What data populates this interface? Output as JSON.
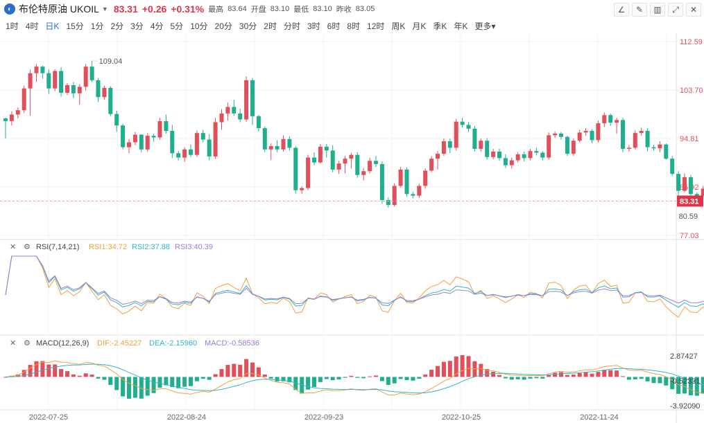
{
  "header": {
    "logo_letter": "◐",
    "symbol": "布伦特原油 UKOIL",
    "price": "83.31",
    "change": "+0.26",
    "change_pct": "+0.31%",
    "high_label": "最高",
    "high": "83.64",
    "open_label": "开盘",
    "open": "83.10",
    "low_label": "最低",
    "low": "83.10",
    "prev_label": "昨收",
    "prev": "83.05"
  },
  "timeframes": [
    "1时",
    "4时",
    "日K",
    "15分",
    "1分",
    "2分",
    "3分",
    "4分",
    "5分",
    "10分",
    "20分",
    "30分",
    "2时",
    "分时",
    "3时",
    "6时",
    "8时",
    "12时",
    "周K",
    "月K",
    "季K",
    "年K",
    "更多"
  ],
  "active_timeframe": "日K",
  "colors": {
    "up": "#e0505a",
    "down": "#1fae8e",
    "accent": "#2a6ccf"
  },
  "chart_data": {
    "type": "candlestick",
    "price_axis": {
      "ticks": [
        112.59,
        103.7,
        94.81,
        85.92,
        77.03
      ],
      "range": [
        76.5,
        113.5
      ],
      "current": "83.31"
    },
    "annotations": {
      "max": "109.04",
      "min": "80.59"
    },
    "dates": [
      "2022-07-25",
      "2022-08-24",
      "2022-09-23",
      "2022-10-25",
      "2022-11-24"
    ],
    "candles": [
      [
        98.5,
        98.6,
        94.8,
        98.0
      ],
      [
        98.0,
        99.8,
        97.2,
        99.2
      ],
      [
        99.2,
        100.5,
        98.5,
        100.0
      ],
      [
        100.0,
        104.5,
        99.5,
        104.0
      ],
      [
        104.0,
        107.5,
        99.0,
        106.8
      ],
      [
        106.8,
        108.5,
        105.2,
        108.0
      ],
      [
        108.0,
        108.2,
        105.8,
        106.8
      ],
      [
        106.8,
        107.5,
        103.0,
        104.0
      ],
      [
        104.0,
        107.5,
        103.5,
        107.2
      ],
      [
        107.2,
        107.9,
        102.5,
        103.2
      ],
      [
        103.2,
        105.0,
        102.8,
        104.6
      ],
      [
        104.6,
        105.2,
        102.2,
        103.1
      ],
      [
        103.1,
        104.8,
        101.0,
        104.3
      ],
      [
        104.3,
        108.5,
        103.6,
        108.0
      ],
      [
        108.0,
        109.04,
        105.2,
        105.5
      ],
      [
        105.5,
        105.9,
        101.5,
        102.4
      ],
      [
        102.4,
        104.5,
        101.9,
        104.1
      ],
      [
        104.1,
        104.4,
        98.9,
        99.3
      ],
      [
        99.3,
        99.9,
        96.0,
        97.2
      ],
      [
        97.2,
        97.5,
        92.8,
        93.2
      ],
      [
        93.2,
        94.7,
        92.1,
        94.1
      ],
      [
        94.1,
        96.0,
        93.6,
        95.5
      ],
      [
        95.5,
        95.6,
        92.3,
        92.8
      ],
      [
        92.8,
        95.8,
        92.4,
        95.3
      ],
      [
        95.3,
        95.7,
        94.2,
        95.0
      ],
      [
        95.0,
        98.6,
        94.6,
        98.0
      ],
      [
        98.0,
        99.2,
        95.7,
        96.2
      ],
      [
        96.2,
        97.3,
        91.2,
        92.1
      ],
      [
        92.1,
        92.5,
        90.8,
        91.3
      ],
      [
        91.3,
        93.2,
        90.5,
        92.8
      ],
      [
        92.8,
        93.7,
        91.4,
        91.8
      ],
      [
        91.8,
        96.3,
        91.4,
        95.8
      ],
      [
        95.8,
        96.4,
        94.1,
        94.6
      ],
      [
        94.6,
        95.6,
        90.8,
        91.5
      ],
      [
        91.5,
        98.6,
        91.1,
        97.8
      ],
      [
        97.8,
        100.2,
        96.4,
        99.4
      ],
      [
        99.4,
        101.4,
        98.1,
        100.6
      ],
      [
        100.6,
        101.9,
        99.0,
        99.4
      ],
      [
        99.4,
        100.3,
        97.8,
        98.3
      ],
      [
        98.3,
        106.2,
        97.9,
        105.5
      ],
      [
        105.5,
        105.9,
        97.3,
        98.9
      ],
      [
        98.9,
        99.1,
        96.1,
        96.7
      ],
      [
        96.7,
        97.0,
        92.3,
        92.8
      ],
      [
        92.8,
        93.9,
        90.9,
        93.4
      ],
      [
        93.4,
        94.5,
        92.3,
        92.8
      ],
      [
        92.8,
        95.4,
        92.4,
        94.7
      ],
      [
        94.7,
        95.2,
        92.6,
        93.1
      ],
      [
        93.1,
        93.4,
        84.7,
        85.3
      ],
      [
        85.3,
        86.0,
        84.6,
        85.7
      ],
      [
        85.7,
        91.8,
        85.3,
        91.3
      ],
      [
        91.3,
        92.3,
        89.9,
        90.4
      ],
      [
        90.4,
        93.8,
        90.2,
        93.3
      ],
      [
        93.3,
        93.8,
        91.3,
        92.6
      ],
      [
        92.6,
        93.6,
        88.6,
        89.1
      ],
      [
        89.1,
        90.7,
        88.3,
        90.2
      ],
      [
        90.2,
        91.6,
        88.4,
        91.1
      ],
      [
        91.1,
        92.2,
        89.3,
        91.8
      ],
      [
        91.8,
        92.3,
        87.6,
        88.1
      ],
      [
        88.1,
        89.4,
        87.1,
        88.8
      ],
      [
        88.8,
        91.3,
        88.4,
        90.7
      ],
      [
        90.7,
        91.6,
        89.6,
        90.1
      ],
      [
        90.1,
        90.6,
        82.8,
        83.5
      ],
      [
        83.5,
        84.0,
        82.1,
        82.6
      ],
      [
        82.6,
        86.6,
        82.3,
        86.1
      ],
      [
        86.1,
        89.6,
        85.8,
        89.1
      ],
      [
        89.1,
        89.5,
        84.1,
        84.6
      ],
      [
        84.6,
        85.0,
        83.8,
        84.3
      ],
      [
        84.3,
        86.5,
        83.9,
        86.1
      ],
      [
        86.1,
        89.3,
        85.6,
        88.9
      ],
      [
        88.9,
        91.6,
        88.6,
        91.1
      ],
      [
        91.1,
        92.5,
        89.1,
        92.0
      ],
      [
        92.0,
        94.8,
        91.6,
        94.3
      ],
      [
        94.3,
        94.8,
        92.1,
        93.1
      ],
      [
        93.1,
        98.4,
        92.6,
        97.9
      ],
      [
        97.9,
        98.6,
        96.8,
        97.3
      ],
      [
        97.3,
        97.8,
        96.0,
        96.6
      ],
      [
        96.6,
        97.1,
        92.4,
        92.9
      ],
      [
        92.9,
        94.8,
        92.4,
        94.4
      ],
      [
        94.4,
        94.9,
        90.9,
        91.4
      ],
      [
        91.4,
        92.9,
        91.0,
        92.4
      ],
      [
        92.4,
        92.9,
        90.7,
        91.2
      ],
      [
        91.2,
        91.9,
        89.4,
        89.9
      ],
      [
        89.9,
        91.3,
        89.3,
        90.8
      ],
      [
        90.8,
        92.3,
        90.4,
        91.9
      ],
      [
        91.9,
        92.4,
        90.6,
        91.2
      ],
      [
        91.2,
        92.9,
        90.8,
        92.5
      ],
      [
        92.5,
        93.1,
        91.7,
        92.2
      ],
      [
        92.2,
        92.5,
        90.8,
        91.3
      ],
      [
        91.3,
        95.9,
        90.9,
        95.4
      ],
      [
        95.4,
        96.1,
        94.9,
        95.7
      ],
      [
        95.7,
        96.0,
        94.6,
        95.1
      ],
      [
        95.1,
        95.3,
        91.6,
        92.0
      ],
      [
        92.0,
        94.8,
        91.6,
        94.4
      ],
      [
        94.4,
        96.4,
        94.1,
        95.9
      ],
      [
        95.9,
        96.7,
        95.3,
        96.2
      ],
      [
        96.2,
        96.5,
        93.9,
        94.5
      ],
      [
        94.5,
        98.1,
        94.1,
        97.6
      ],
      [
        97.6,
        99.6,
        96.9,
        99.1
      ],
      [
        99.1,
        99.4,
        97.1,
        97.7
      ],
      [
        97.7,
        98.6,
        95.7,
        98.2
      ],
      [
        98.2,
        98.6,
        92.3,
        92.9
      ],
      [
        92.9,
        93.6,
        92.4,
        93.1
      ],
      [
        93.1,
        96.3,
        92.8,
        95.8
      ],
      [
        95.8,
        96.8,
        95.3,
        96.2
      ],
      [
        96.2,
        96.7,
        92.5,
        93.2
      ],
      [
        93.2,
        93.6,
        92.6,
        93.0
      ],
      [
        93.0,
        94.3,
        92.3,
        93.7
      ],
      [
        93.7,
        93.9,
        90.9,
        91.1
      ],
      [
        91.1,
        91.6,
        87.9,
        88.3
      ],
      [
        88.3,
        88.8,
        83.6,
        85.2
      ],
      [
        85.2,
        88.4,
        84.9,
        87.7
      ],
      [
        87.7,
        88.1,
        84.2,
        84.6
      ],
      [
        84.6,
        84.9,
        83.7,
        84.3
      ],
      [
        84.3,
        86.1,
        84.0,
        85.6
      ],
      [
        85.6,
        85.9,
        80.59,
        82.4
      ],
      [
        82.4,
        84.3,
        82.0,
        83.4
      ],
      [
        83.4,
        86.8,
        83.0,
        86.4
      ],
      [
        86.4,
        89.4,
        85.2,
        85.6
      ],
      [
        85.6,
        87.2,
        85.2,
        86.9
      ],
      [
        86.9,
        87.5,
        85.7,
        86.0
      ],
      [
        86.0,
        87.9,
        82.9,
        83.31
      ]
    ],
    "rsi": {
      "label": "RSI(7,14,21)",
      "rsi1": "RSI1:34.72",
      "rsi2": "RSI2:37.88",
      "rsi3": "RSI3:40.39",
      "range": [
        0,
        100
      ]
    },
    "macd": {
      "label": "MACD(12,26,9)",
      "dif": "DIF:-2.45227",
      "dea": "DEA:-2.15960",
      "macd": "MACD:-0.58536",
      "ticks": [
        "2.87427",
        "-0.52331",
        "-3.92090"
      ],
      "tick_values": [
        2.87427,
        -0.52331,
        -3.9209
      ]
    }
  }
}
